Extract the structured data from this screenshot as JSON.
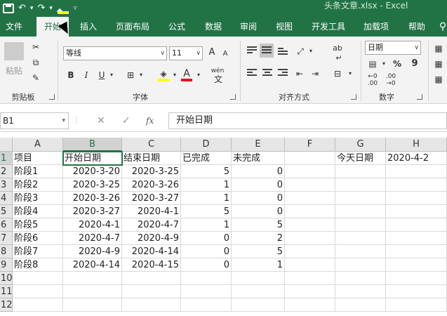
{
  "window": {
    "title": "头条文章.xlsx  -  Excel"
  },
  "tabs": [
    "文件",
    "开始",
    "插入",
    "页面布局",
    "公式",
    "数据",
    "审阅",
    "视图",
    "开发工具",
    "加载项",
    "帮助"
  ],
  "ribbon": {
    "clipboard": {
      "paste_label": "粘贴",
      "group_label": "剪贴板"
    },
    "font": {
      "font_name": "等线",
      "font_size": "11",
      "bold": "B",
      "italic": "I",
      "underline": "U",
      "grow": "A",
      "shrink": "A",
      "phonetic": "wén",
      "group_label": "字体"
    },
    "alignment": {
      "wrap": "ab",
      "group_label": "对齐方式"
    },
    "number": {
      "format": "日期",
      "percent": "%",
      "comma": "9",
      "group_label": "数字"
    }
  },
  "formula_bar": {
    "name_box": "B1",
    "cancel": "✕",
    "enter": "✓",
    "fx": "fx",
    "formula": "开始日期"
  },
  "sheet": {
    "columns": [
      "A",
      "B",
      "C",
      "D",
      "E",
      "F",
      "G",
      "H"
    ],
    "row_numbers": [
      "1",
      "2",
      "3",
      "4",
      "5",
      "6",
      "7",
      "8",
      "9",
      "10",
      "11",
      "12"
    ],
    "rows": [
      [
        "项目",
        "开始日期",
        "结束日期",
        "已完成",
        "未完成",
        "",
        "今天日期",
        "2020-4-2"
      ],
      [
        "阶段1",
        "2020-3-20",
        "2020-3-25",
        "5",
        "0",
        "",
        "",
        ""
      ],
      [
        "阶段2",
        "2020-3-25",
        "2020-3-26",
        "1",
        "0",
        "",
        "",
        ""
      ],
      [
        "阶段3",
        "2020-3-26",
        "2020-3-27",
        "1",
        "0",
        "",
        "",
        ""
      ],
      [
        "阶段4",
        "2020-3-27",
        "2020-4-1",
        "5",
        "0",
        "",
        "",
        ""
      ],
      [
        "阶段5",
        "2020-4-1",
        "2020-4-7",
        "1",
        "5",
        "",
        "",
        ""
      ],
      [
        "阶段6",
        "2020-4-7",
        "2020-4-9",
        "0",
        "2",
        "",
        "",
        ""
      ],
      [
        "阶段7",
        "2020-4-9",
        "2020-4-14",
        "0",
        "5",
        "",
        "",
        ""
      ],
      [
        "阶段8",
        "2020-4-14",
        "2020-4-15",
        "0",
        "1",
        "",
        "",
        ""
      ]
    ]
  }
}
